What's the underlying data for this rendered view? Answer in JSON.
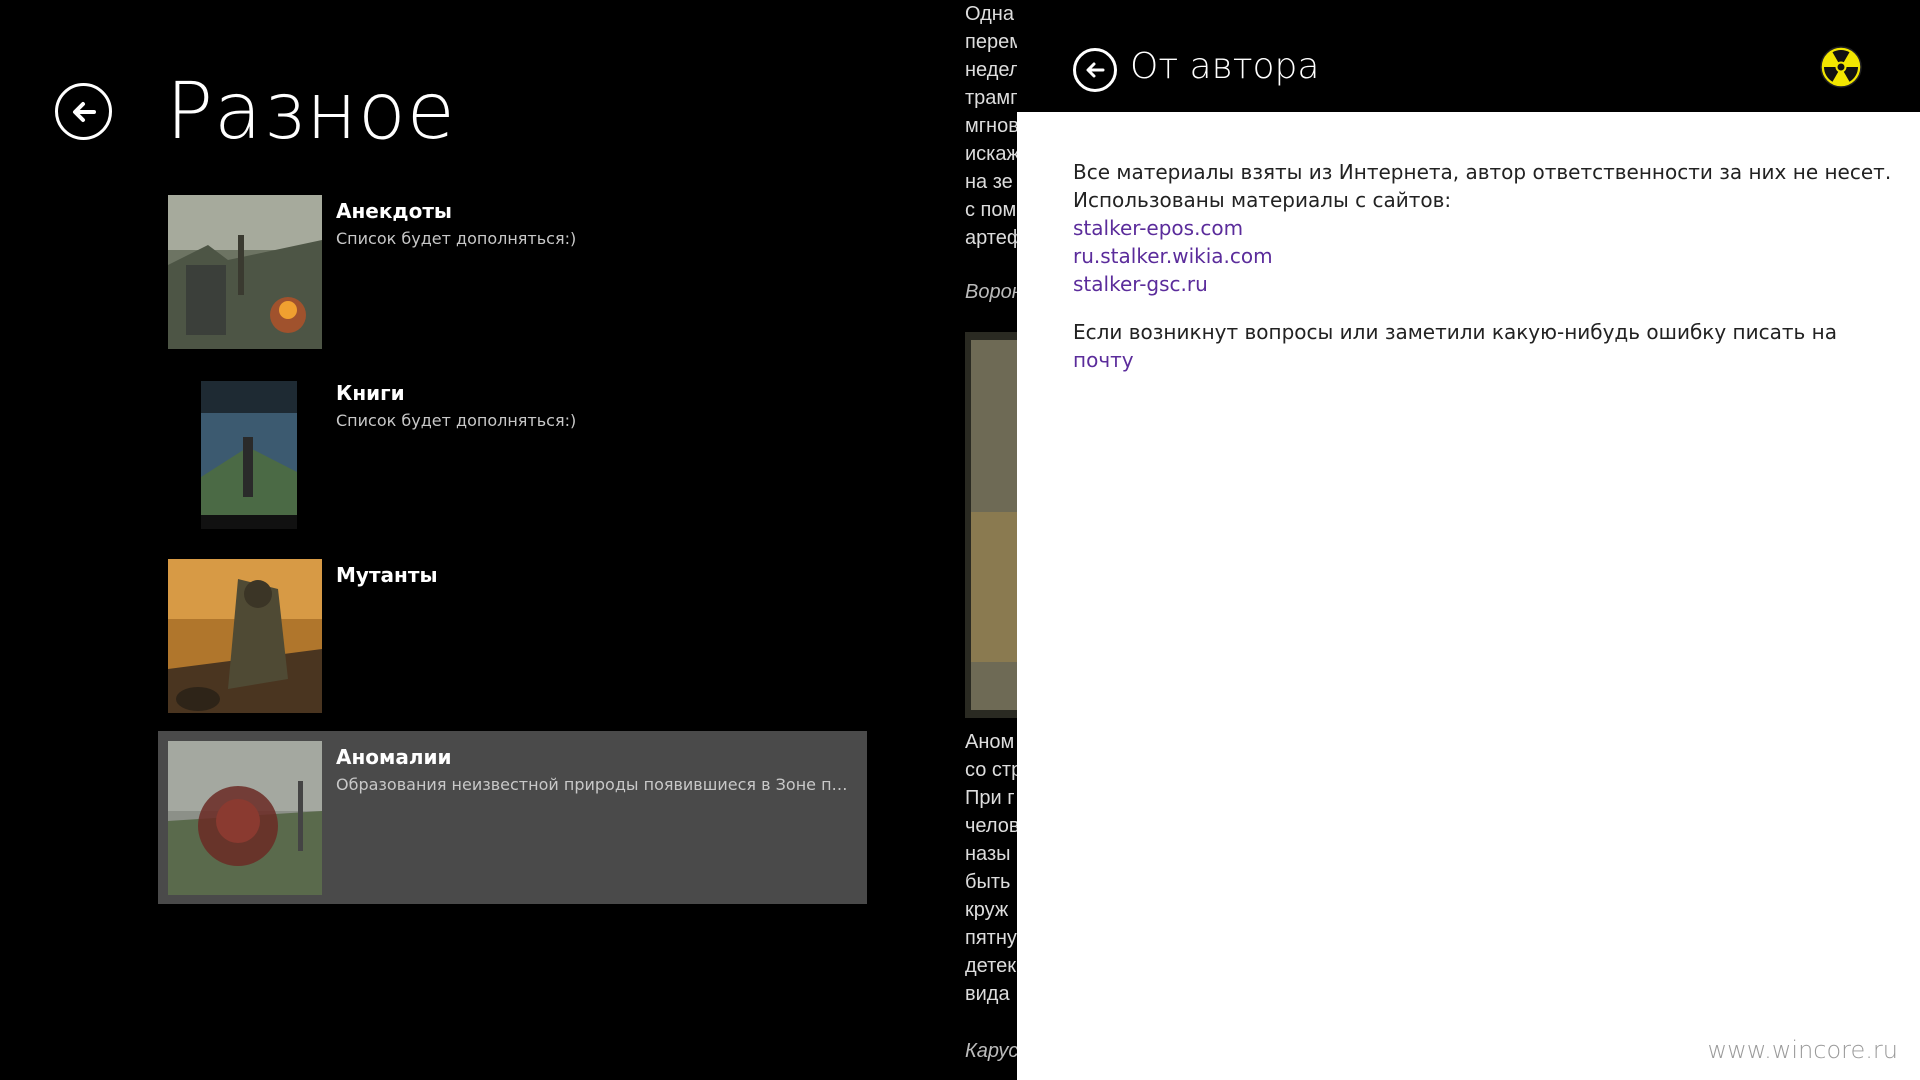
{
  "main": {
    "title": "Разное",
    "items": [
      {
        "title": "Анекдоты",
        "subtitle": "Список будет дополняться:)",
        "thumb": "campfire-scene-thumbnail"
      },
      {
        "title": "Книги",
        "subtitle": "Список будет дополняться:)",
        "thumb": "book-cover-thumbnail"
      },
      {
        "title": "Мутанты",
        "subtitle": "",
        "thumb": "mutant-art-thumbnail"
      },
      {
        "title": "Аномалии",
        "subtitle": "Образования неизвестной природы появившиеся в Зоне посл...",
        "thumb": "anomaly-thumbnail",
        "selected": true
      }
    ]
  },
  "article_strip": {
    "lines_top": [
      "Одна",
      "перем",
      "недел",
      "трамп",
      "мгнов",
      "искаж",
      "на зе",
      "с пом",
      "артеф"
    ],
    "italic_1": "Ворон",
    "lines_bottom": [
      "Аном",
      "со стр",
      "При г",
      "челов",
      "назы",
      "быть",
      "круж",
      "пятну",
      "детек",
      "вида"
    ],
    "italic_2": "Карус"
  },
  "flyout": {
    "title": "От автора",
    "paragraph_1": "Все материалы взяты из Интернета, автор ответственности за них не несет.",
    "paragraph_2": "Использованы материалы с сайтов:",
    "links": [
      "stalker-epos.com",
      "ru.stalker.wikia.com",
      "stalker-gsc.ru"
    ],
    "contact_text": "Если возникнут вопросы или заметили какую-нибудь ошибку писать на ",
    "contact_link": "почту",
    "logo_icon": "radiation-icon"
  },
  "watermark": "www.wincore.ru",
  "colors": {
    "background": "#000000",
    "selected_item": "#4a4a4a",
    "link": "#5b2c9b",
    "radiation_yellow": "#f2e600"
  }
}
